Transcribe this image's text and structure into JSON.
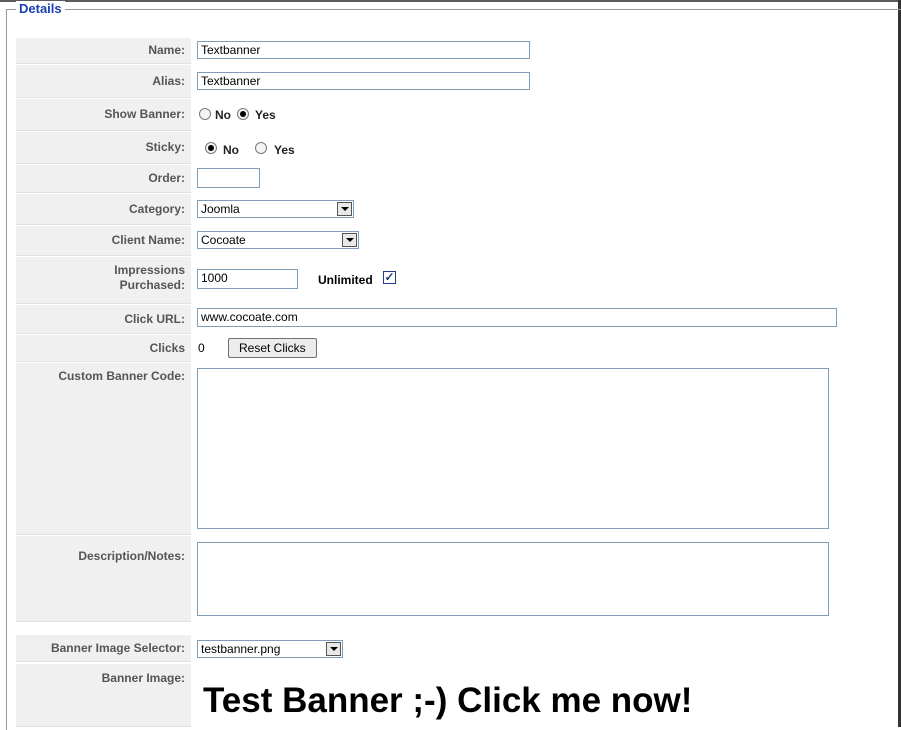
{
  "fieldset": {
    "legend": "Details"
  },
  "fields": {
    "name": {
      "label": "Name:",
      "value": "Textbanner"
    },
    "alias": {
      "label": "Alias:",
      "value": "Textbanner"
    },
    "show_banner": {
      "label": "Show Banner:",
      "options": [
        "No",
        "Yes"
      ],
      "selected": "Yes"
    },
    "sticky": {
      "label": "Sticky:",
      "options": [
        "No",
        "Yes"
      ],
      "selected": "No"
    },
    "order": {
      "label": "Order:",
      "value": ""
    },
    "category": {
      "label": "Category:",
      "value": "Joomla"
    },
    "client_name": {
      "label": "Client Name:",
      "value": "Cocoate"
    },
    "impressions": {
      "label_line1": "Impressions",
      "label_line2": "Purchased:",
      "value": "1000",
      "unlimited_label": "Unlimited",
      "unlimited_checked": true
    },
    "click_url": {
      "label": "Click URL:",
      "value": "www.cocoate.com"
    },
    "clicks": {
      "label": "Clicks",
      "value": "0",
      "reset_label": "Reset Clicks"
    },
    "custom_banner_code": {
      "label": "Custom Banner Code:",
      "value": ""
    },
    "description": {
      "label": "Description/Notes:",
      "value": ""
    },
    "banner_image_selector": {
      "label": "Banner Image Selector:",
      "value": "testbanner.png"
    },
    "banner_image": {
      "label": "Banner Image:",
      "preview_text": "Test Banner ;-) Click me now!"
    }
  },
  "colors": {
    "legend": "#1a3fb5",
    "label_bg": "#f0f0f0",
    "input_border": "#7f9db9"
  }
}
